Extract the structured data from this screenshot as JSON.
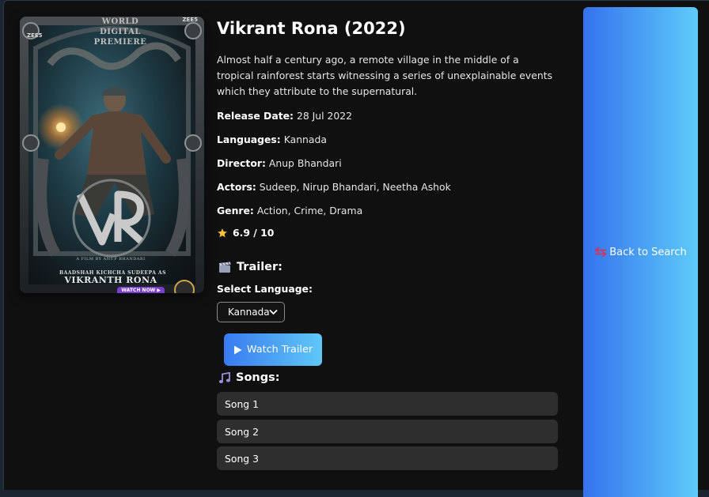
{
  "poster": {
    "top_text": "WORLD\nDIGITAL PREMIERE",
    "credit": "A FILM BY ANUP BHANDARI",
    "cast_line": "BAADSHAH  KICHCHA SUDEEPA  AS",
    "name_line": "VIKRANTH RONA",
    "badge_left": "ZEE5",
    "badge_right": "ZEE5",
    "watch_badge": "WATCH NOW ▶"
  },
  "movie": {
    "title": "Vikrant Rona (2022)",
    "description": "Almost half a century ago, a remote village in the middle of a tropical rainforest starts witnessing a series of unexplainable events which they attribute to the supernatural.",
    "release_label": "Release Date:",
    "release_value": "28 Jul 2022",
    "languages_label": "Languages:",
    "languages_value": "Kannada",
    "director_label": "Director:",
    "director_value": "Anup Bhandari",
    "actors_label": "Actors:",
    "actors_value": "Sudeep, Nirup Bhandari, Neetha Ashok",
    "genre_label": "Genre:",
    "genre_value": "Action, Crime, Drama",
    "rating": "6.9 / 10",
    "rating_icon": "star-icon"
  },
  "trailer": {
    "heading": "Trailer:",
    "heading_icon": "clapperboard-icon",
    "select_label": "Select Language:",
    "selected_language": "Kannada",
    "watch_button": "Watch Trailer",
    "watch_icon": "play-icon"
  },
  "songs": {
    "heading": "Songs:",
    "heading_icon": "music-note-icon",
    "items": [
      "Song 1",
      "Song 2",
      "Song 3"
    ]
  },
  "nav": {
    "back_label": "Back to Search",
    "back_icon": "back-arrows-icon"
  },
  "colors": {
    "accent_start": "#3572ee",
    "accent_end": "#5ecbf9",
    "background": "#101010",
    "song_bg": "#2e2e2e"
  }
}
